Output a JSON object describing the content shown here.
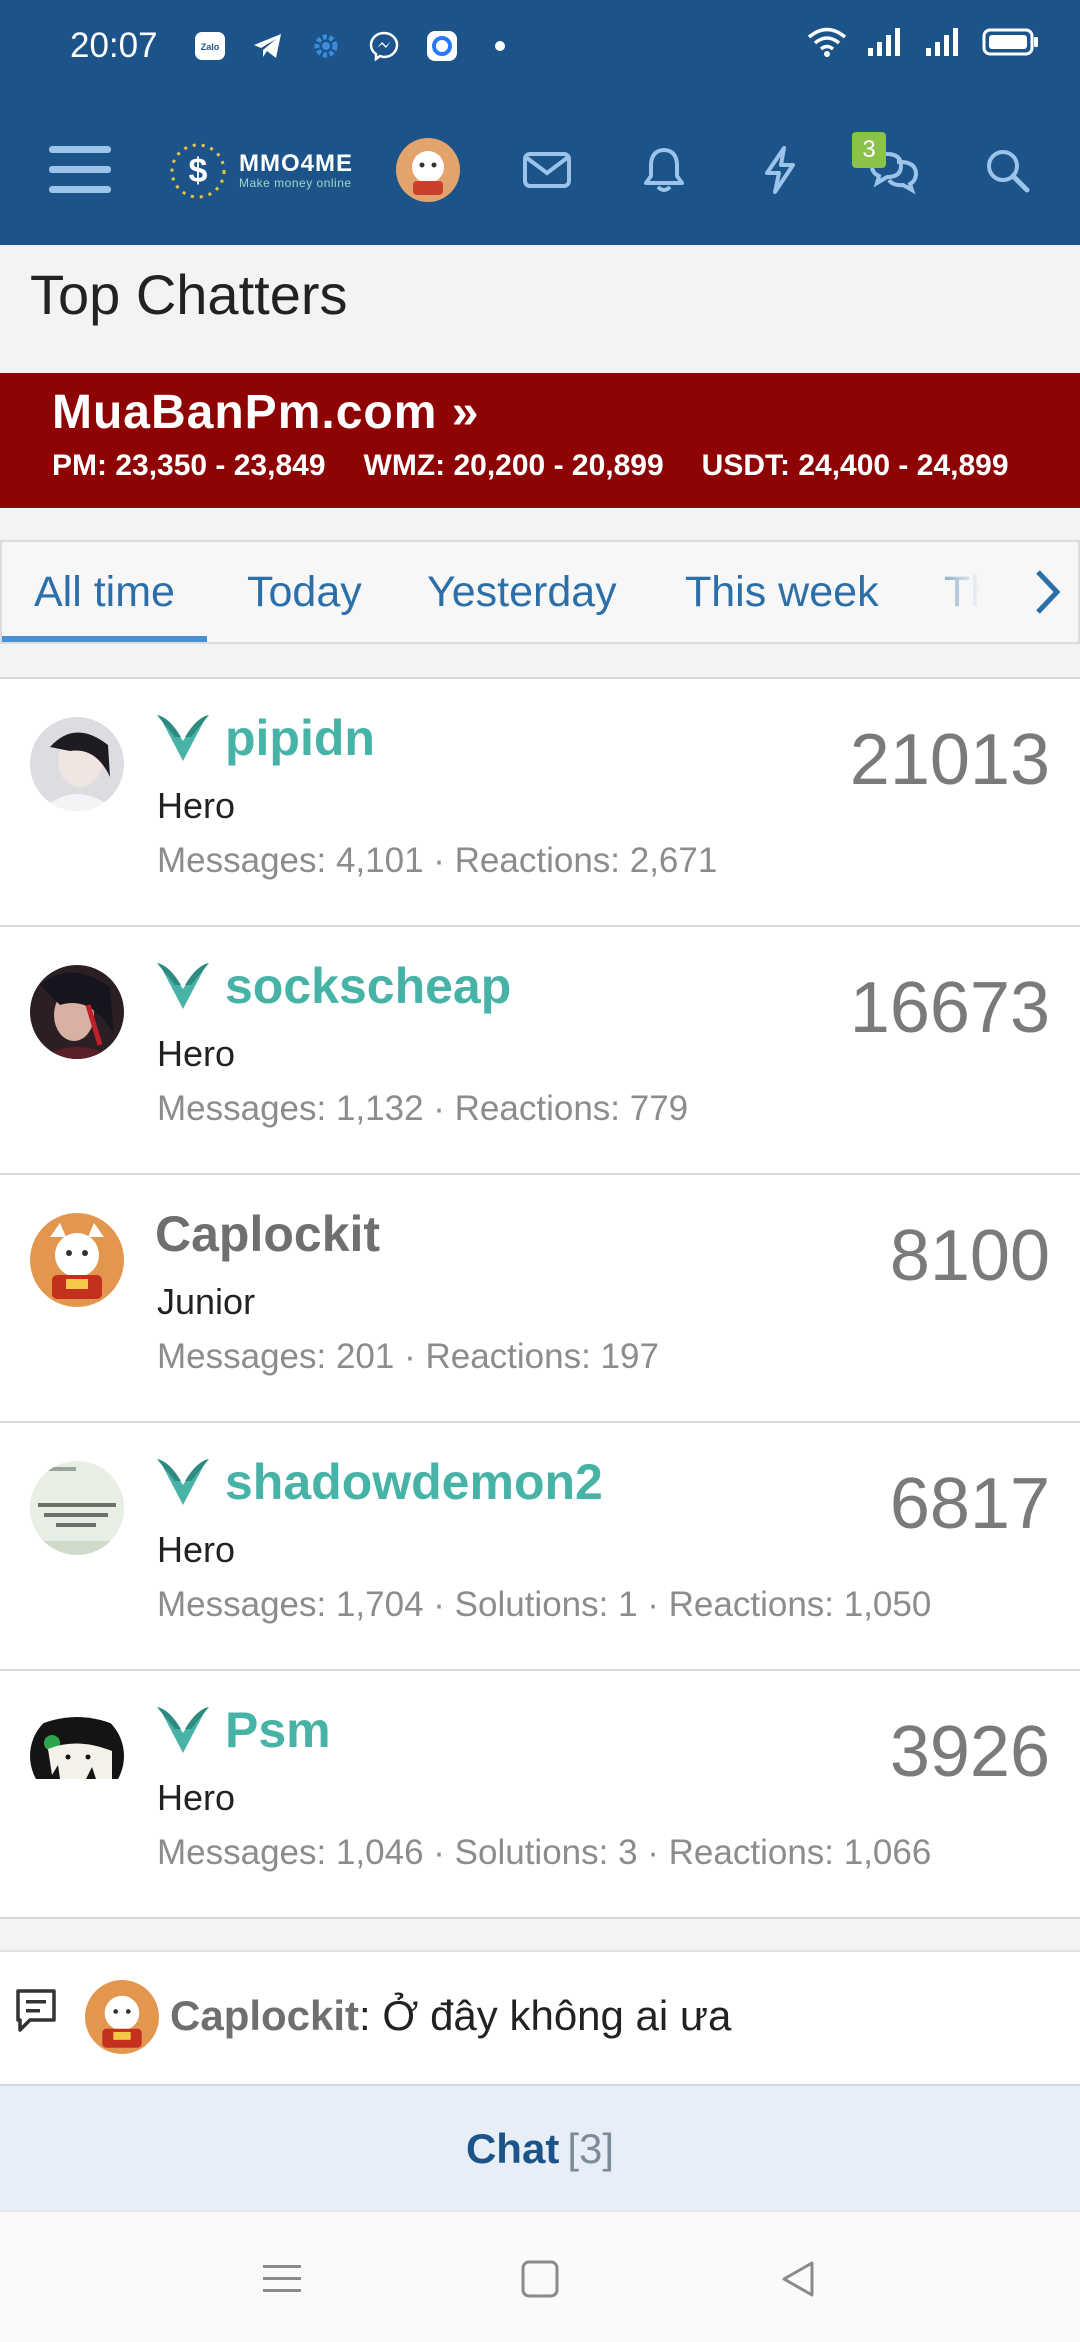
{
  "status_bar": {
    "time": "20:07",
    "notification_icons": [
      "zalo-icon",
      "telegram-icon",
      "gear-icon",
      "messenger-icon",
      "signal-app-icon",
      "dot-icon"
    ],
    "right_icons": [
      "wifi-icon",
      "cell-signal-icon",
      "cell-signal-icon",
      "battery-icon"
    ],
    "zalo_label": "Zalo"
  },
  "header": {
    "logo_text": "MMO4ME",
    "logo_tagline": "Make money online",
    "chat_badge": "3",
    "colors": {
      "background": "#1c5489",
      "badge": "#8bc34a"
    }
  },
  "page": {
    "title": "Top Chatters"
  },
  "banner": {
    "title": "MuaBanPm.com »",
    "rates": [
      "PM: 23,350 - 23,849",
      "WMZ: 20,200 - 20,899",
      "USDT: 24,400 - 24,899"
    ],
    "color": "#8e0404"
  },
  "tabs": {
    "items": [
      "All time",
      "Today",
      "Yesterday",
      "This week",
      "Th"
    ],
    "active": "All time"
  },
  "chatters": [
    {
      "name": "pipidn",
      "title": "Hero",
      "stats": "Messages: 4,101 · Reactions: 2,671",
      "score": "21013",
      "has_badge": true
    },
    {
      "name": "sockscheap",
      "title": "Hero",
      "stats": "Messages: 1,132 · Reactions: 779",
      "score": "16673",
      "has_badge": true
    },
    {
      "name": "Caplockit",
      "title": "Junior",
      "stats": "Messages: 201 · Reactions: 197",
      "score": "8100",
      "has_badge": false
    },
    {
      "name": "shadowdemon2",
      "title": "Hero",
      "stats": "Messages: 1,704 · Solutions: 1 · Reactions: 1,050",
      "score": "6817",
      "has_badge": true
    },
    {
      "name": "Psm",
      "title": "Hero",
      "stats": "Messages: 1,046 · Solutions: 3 · Reactions: 1,066",
      "score": "3926",
      "has_badge": true
    }
  ],
  "ticker": {
    "user": "Caplockit",
    "separator": ": ",
    "message": "Ở đây không ai ưa"
  },
  "chat_bar": {
    "label": "Chat",
    "count": "[3]"
  },
  "system_nav": [
    "menu-icon",
    "home-icon",
    "back-icon"
  ],
  "colors": {
    "username": "#47b3a7",
    "tab": "#2c6fa8",
    "link": "#1c5489"
  }
}
